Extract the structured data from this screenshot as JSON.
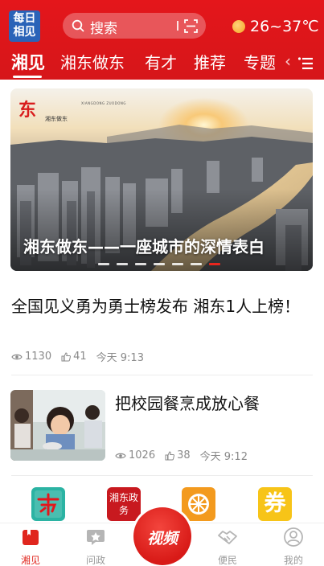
{
  "header": {
    "logo_line1": "每日",
    "logo_line2": "相见",
    "search_placeholder": "搜索",
    "weather_temp": "26~37℃",
    "tabs": [
      "湘见",
      "湘东做东",
      "有才",
      "推荐",
      "专题"
    ],
    "tab_overflow": "‹"
  },
  "banner": {
    "brand_mark": "东",
    "brand_name": "湘东做东",
    "brand_sub": "XIANGDONG ZUODONG",
    "title": "湘东做东——一座城市的深情表白",
    "slide_count": 7,
    "active_slide": 7
  },
  "news": [
    {
      "title": "全国见义勇为勇士榜发布 湘东1人上榜！",
      "views": "1130",
      "likes": "41",
      "time": "今天 9:13"
    },
    {
      "title": "把校园餐烹成放心餐",
      "views": "1026",
      "likes": "38",
      "time": "今天 9:12"
    }
  ],
  "quick_links": [
    {
      "icon": "xiangdong-logo-icon",
      "color": "#2bb3a3"
    },
    {
      "icon": "xiangdong-gov-icon",
      "label": "湘东政务",
      "color": "#c8191f"
    },
    {
      "icon": "orange-slice-icon",
      "color": "#f39a1e"
    },
    {
      "icon": "coupon-icon",
      "label": "券",
      "color": "#f7c418"
    }
  ],
  "bottom_nav": {
    "items": [
      {
        "label": "湘见",
        "icon": "home-book-icon",
        "active": true
      },
      {
        "label": "问政",
        "icon": "star-chat-icon",
        "active": false
      },
      {
        "label": "便民",
        "icon": "handshake-icon",
        "active": false
      },
      {
        "label": "我的",
        "icon": "user-icon",
        "active": false
      }
    ],
    "center_label": "视频"
  },
  "colors": {
    "brand_red": "#e4161b",
    "active_dot": "#e8261e",
    "meta_gray": "#8a8a8a"
  }
}
